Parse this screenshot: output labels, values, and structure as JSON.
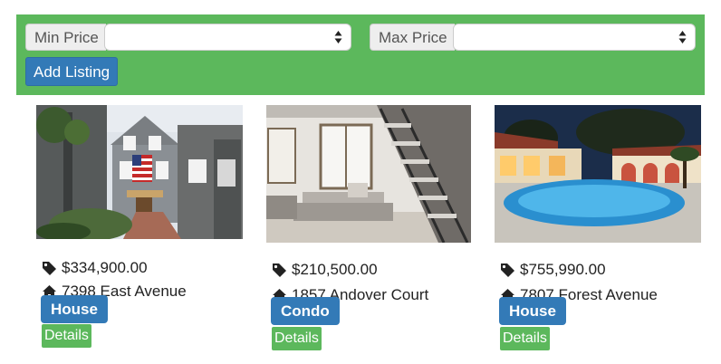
{
  "filters": {
    "min_price_label": "Min Price",
    "min_price_value": "",
    "max_price_label": "Max Price",
    "max_price_value": ""
  },
  "toolbar": {
    "add_listing_label": "Add Listing"
  },
  "listings": [
    {
      "price": "$334,900.00",
      "address": "7398 East Avenue",
      "type": "House",
      "details_label": "Details"
    },
    {
      "price": "$210,500.00",
      "address": "1857 Andover Court",
      "type": "Condo",
      "details_label": "Details"
    },
    {
      "price": "$755,990.00",
      "address": "7807 Forest Avenue",
      "type": "House",
      "details_label": "Details"
    }
  ],
  "icons": {
    "price": "tag-icon",
    "address": "home-icon",
    "select": "select-arrows-icon"
  },
  "colors": {
    "filter_bar": "#5cb85c",
    "primary": "#337ab7",
    "success": "#5cb85c"
  }
}
